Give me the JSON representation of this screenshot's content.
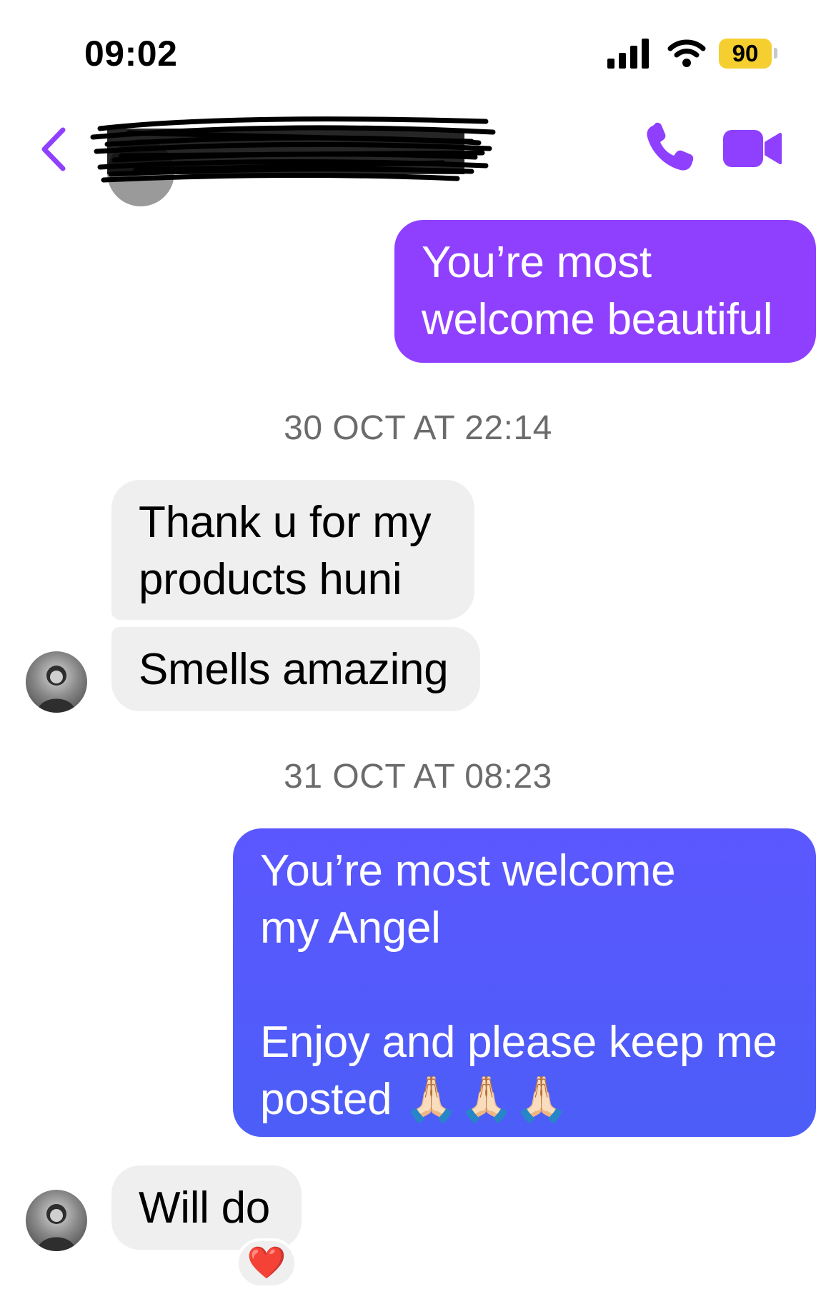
{
  "status_bar": {
    "time": "09:02",
    "battery": "90",
    "battery_color": "#f5cf2f"
  },
  "header": {
    "back_icon": "chevron-left-icon",
    "call_icon": "phone-icon",
    "video_icon": "video-camera-icon",
    "accent_color": "#8f40ff"
  },
  "messages": [
    {
      "side": "sent",
      "lines": [
        "You’re most",
        "welcome beautiful"
      ]
    },
    {
      "side": "timestamp",
      "text": "30 OCT AT 22:14"
    },
    {
      "side": "received",
      "lines": [
        "Thank u for my",
        "products huni"
      ]
    },
    {
      "side": "received",
      "lines": [
        "Smells amazing"
      ]
    },
    {
      "side": "timestamp",
      "text": "31 OCT AT 08:23"
    },
    {
      "side": "sent",
      "lines": [
        "You’re most welcome",
        "my Angel",
        "",
        "Enjoy and please keep me",
        "posted 🙏🏻🙏🏻🙏🏻"
      ]
    },
    {
      "side": "received",
      "lines": [
        "Will do"
      ],
      "reaction": "❤️"
    }
  ],
  "colors": {
    "sent_bubble_1": "#8f40ff",
    "sent_bubble_2": "#5b57ff",
    "received_bubble": "#efefef",
    "timestamp_text": "#6b6b6b"
  }
}
